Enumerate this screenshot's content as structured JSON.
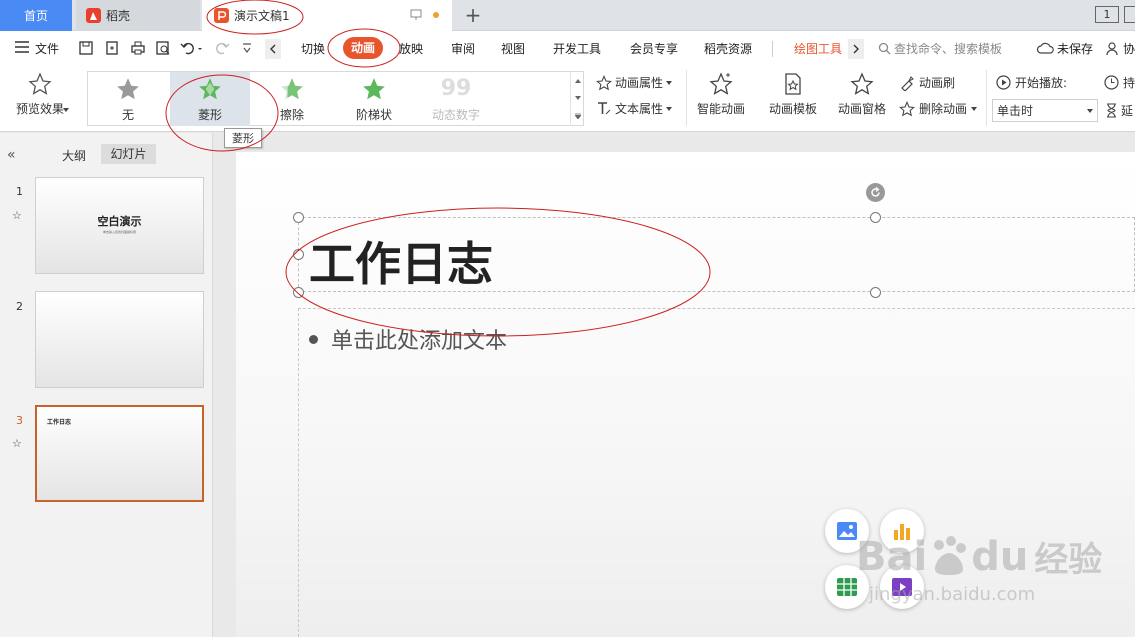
{
  "tabs": {
    "home": "首页",
    "daoke": "稻壳",
    "document": "演示文稿1",
    "page_indicator": "1"
  },
  "menu": {
    "file": "文件",
    "items": [
      "切换",
      "动画",
      "放映",
      "审阅",
      "视图",
      "开发工具",
      "会员专享",
      "稻壳资源"
    ],
    "drawing_tools": "绘图工具",
    "search_placeholder": "查找命令、搜索模板",
    "unsaved": "未保存",
    "collab": "协"
  },
  "ribbon": {
    "preview": "预览效果",
    "effects": [
      "无",
      "菱形",
      "擦除",
      "阶梯状",
      "动态数字"
    ],
    "anim_props": "动画属性",
    "text_props": "文本属性",
    "smart_anim": "智能动画",
    "anim_template": "动画模板",
    "anim_pane": "动画窗格",
    "anim_brush": "动画刷",
    "delete_anim": "删除动画",
    "start_play": "开始播放:",
    "start_value": "单击时",
    "duration": "持",
    "delay": "延",
    "tooltip": "菱形"
  },
  "left_panel": {
    "outline_tab": "大纲",
    "slides_tab": "幻灯片",
    "slides": [
      {
        "num": "1",
        "title": "空白演示",
        "subtitle": "单击输入您的封面副标题"
      },
      {
        "num": "2",
        "title": "",
        "subtitle": ""
      },
      {
        "num": "3",
        "title": "工作日志",
        "subtitle": ""
      }
    ]
  },
  "slide": {
    "title": "工作日志",
    "body_placeholder": "单击此处添加文本"
  },
  "watermark": {
    "brand": "Bai",
    "brand2": "du",
    "cn": "经验",
    "url": "jingyan.baidu.com"
  },
  "colors": {
    "accent": "#e8552d",
    "home_tab": "#4a8af4",
    "drawing_tools": "#e8552d",
    "annotation": "#cc2020"
  }
}
